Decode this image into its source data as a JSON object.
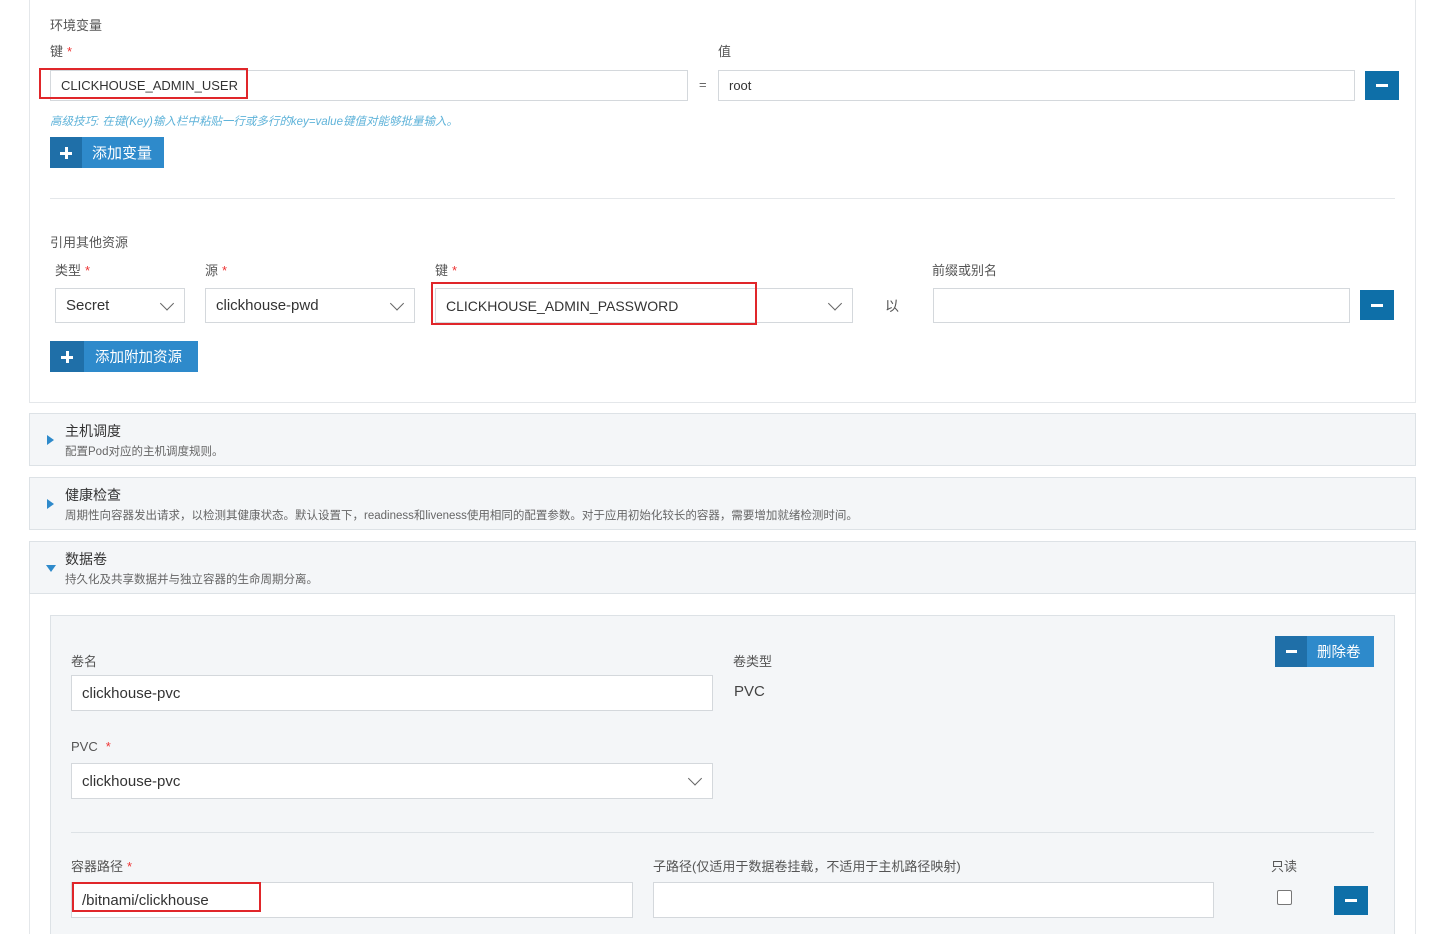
{
  "env": {
    "section_label": "环境变量",
    "key_label": "键",
    "key_required": "*",
    "value_label": "值",
    "key_value": "CLICKHOUSE_ADMIN_USER",
    "equals": "=",
    "value_value": "root",
    "tip": "高级技巧: 在键(Key)输入栏中粘贴一行或多行的key=value键值对能够批量输入。",
    "add_button": "添加变量"
  },
  "ref": {
    "section_label": "引用其他资源",
    "type_label": "类型",
    "source_label": "源",
    "key_label": "键",
    "required": "*",
    "prefix_label": "前缀或别名",
    "type_value": "Secret",
    "source_value": "clickhouse-pwd",
    "key_value": "CLICKHOUSE_ADMIN_PASSWORD",
    "as_text": "以",
    "add_button": "添加附加资源"
  },
  "panels": [
    {
      "title": "主机调度",
      "desc": "配置Pod对应的主机调度规则。"
    },
    {
      "title": "健康检查",
      "desc": "周期性向容器发出请求，以检测其健康状态。默认设置下，readiness和liveness使用相同的配置参数。对于应用初始化较长的容器，需要增加就绪检测时间。"
    },
    {
      "title": "数据卷",
      "desc": "持久化及共享数据并与独立容器的生命周期分离。"
    }
  ],
  "volume": {
    "name_label": "卷名",
    "name_value": "clickhouse-pvc",
    "type_label": "卷类型",
    "type_value": "PVC",
    "delete_button": "删除卷",
    "pvc_label": "PVC",
    "pvc_required": "*",
    "pvc_value": "clickhouse-pvc",
    "mount_path_label": "容器路径",
    "mount_required": "*",
    "mount_path_value": "/bitnami/clickhouse",
    "subpath_label": "子路径(仅适用于数据卷挂载，不适用于主机路径映射)",
    "subpath_value": "",
    "readonly_label": "只读"
  },
  "colors": {
    "primary": "#0e6fa8",
    "accent": "#2e8acb",
    "highlight": "#e0262a"
  }
}
